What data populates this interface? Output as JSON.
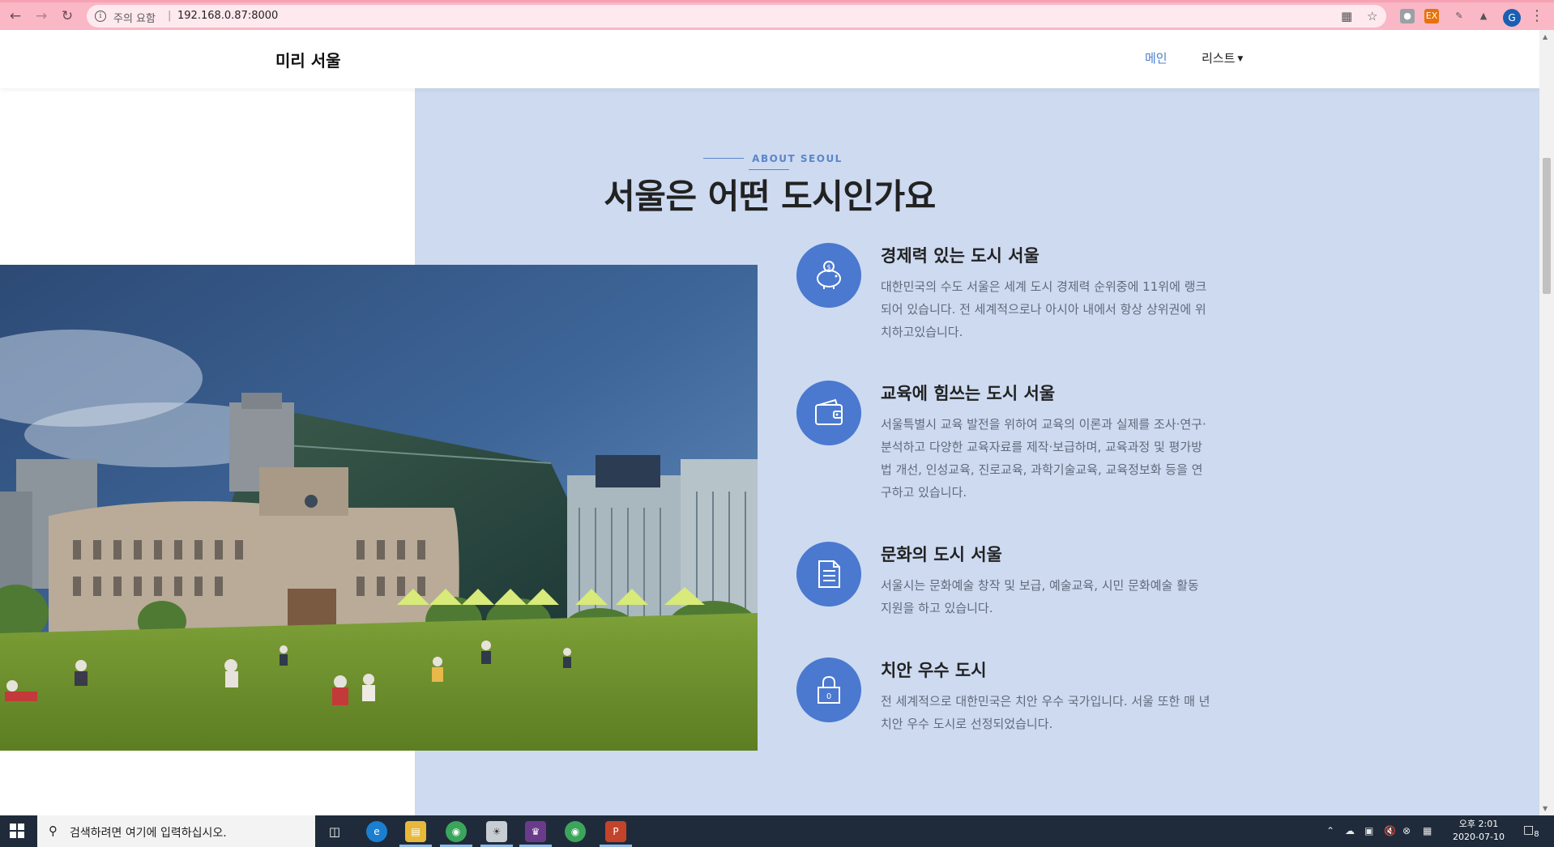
{
  "browser": {
    "security_label": "주의 요함",
    "separator": "|",
    "url": "192.168.0.87:8000",
    "profile_initial": "G",
    "ext_label_ex": "EX"
  },
  "site": {
    "brand": "미리 서울",
    "nav": {
      "main": "메인",
      "list": "리스트"
    }
  },
  "about": {
    "eyebrow": "ABOUT SEOUL",
    "title": "서울은 어떤 도시인가요",
    "features": [
      {
        "icon": "piggy-bank-icon",
        "title": "경제력 있는 도시 서울",
        "text": "대한민국의 수도 서울은 세계 도시 경제력 순위중에 11위에 랭크되어 있습니다. 전 세계적으로나 아시아 내에서 항상 상위권에 위치하고있습니다."
      },
      {
        "icon": "wallet-icon",
        "title": "교육에 힘쓰는 도시 서울",
        "text": "서울특별시 교육 발전을 위하여 교육의 이론과 실제를 조사·연구·분석하고 다양한 교육자료를 제작·보급하며, 교육과정 및 평가방법 개선, 인성교육, 진로교육, 과학기술교육, 교육정보화 등을 연구하고 있습니다."
      },
      {
        "icon": "document-icon",
        "title": "문화의 도시 서울",
        "text": "서울시는 문화예술 창작 및 보급, 예술교육, 시민 문화예술 활동 지원을 하고 있습니다."
      },
      {
        "icon": "lock-icon",
        "title": "치안 우수 도시",
        "text": "전 세계적으로 대한민국은 치안 우수 국가입니다. 서울 또한 매 년 치안 우수 도시로 선정되었습니다."
      }
    ]
  },
  "taskbar": {
    "search_placeholder": "검색하려면 여기에 입력하십시오.",
    "time": "오후 2:01",
    "date": "2020-07-10",
    "notification_count": "8"
  },
  "colors": {
    "accent_blue": "#4a79cf",
    "panel_bg": "#cddaf0",
    "chrome_pink": "#fab7c6"
  }
}
